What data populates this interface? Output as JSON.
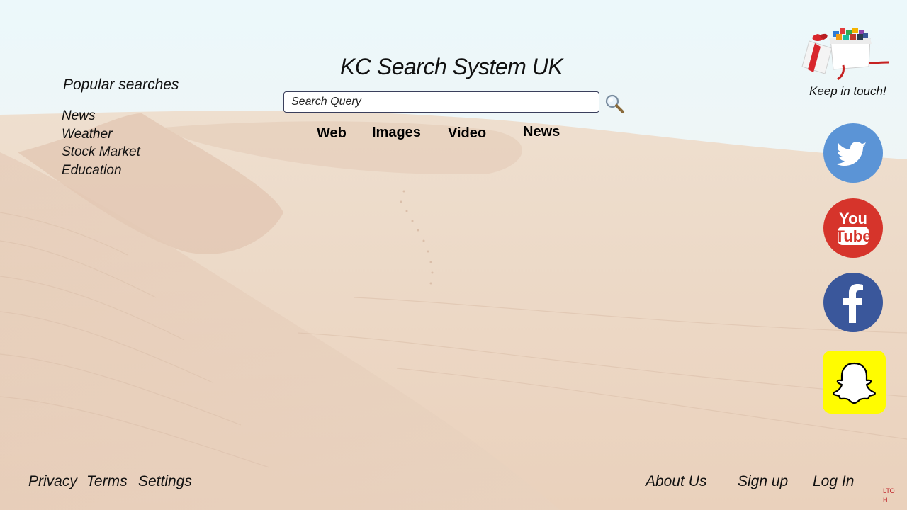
{
  "site": {
    "title": "KC Search System UK"
  },
  "search": {
    "placeholder": "Search Query"
  },
  "tabs": [
    "Web",
    "Images",
    "Video",
    "News"
  ],
  "popular": {
    "title": "Popular searches",
    "items": [
      "News",
      "Weather",
      "Stock Market",
      "Education"
    ]
  },
  "social": {
    "keep_label": "Keep in touch!",
    "icons": [
      "twitter-icon",
      "youtube-icon",
      "facebook-icon",
      "snapchat-icon"
    ],
    "youtube_text": [
      "You",
      "Tube"
    ],
    "colors": {
      "twitter": "#5b94d6",
      "youtube": "#d6342b",
      "facebook": "#3a579b",
      "snapchat": "#fffc00"
    }
  },
  "footer": {
    "left": [
      "Privacy",
      "Terms",
      "Settings"
    ],
    "right": [
      "About Us",
      "Sign up",
      "Log In"
    ],
    "corner_line1": "LTO",
    "corner_line2": "H"
  }
}
